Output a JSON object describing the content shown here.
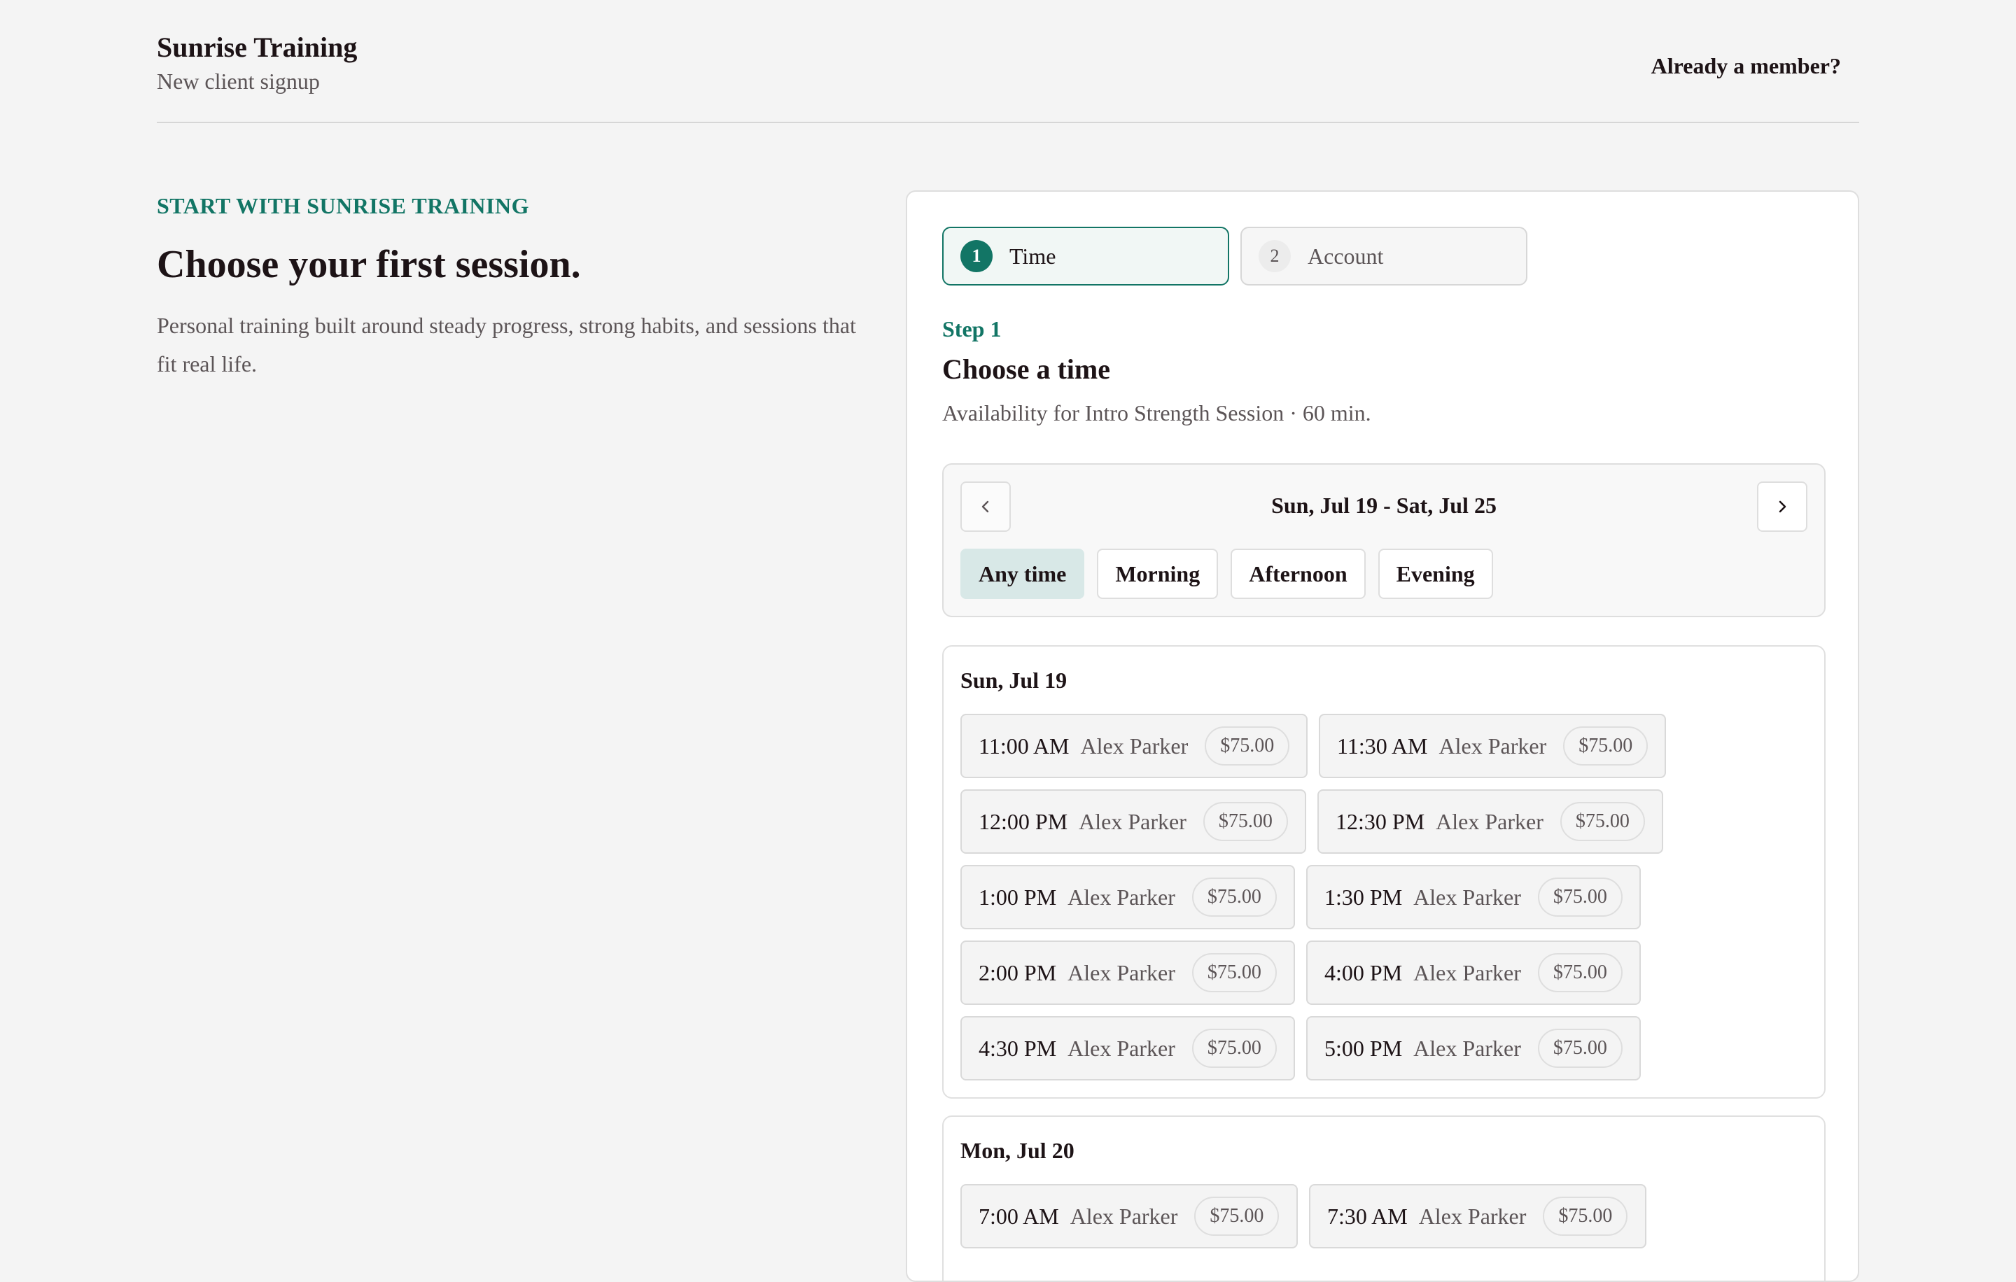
{
  "header": {
    "brand_name": "Sunrise Training",
    "brand_sub": "New client signup",
    "member_link": "Already a member?"
  },
  "intro": {
    "eyebrow": "START WITH SUNRISE TRAINING",
    "headline": "Choose your first session.",
    "text": "Personal training built around steady progress, strong habits, and sessions that fit real life."
  },
  "steps": [
    {
      "number": "1",
      "label": "Time",
      "active": true
    },
    {
      "number": "2",
      "label": "Account",
      "active": false
    }
  ],
  "step_content": {
    "eyebrow": "Step 1",
    "title": "Choose a time",
    "description": "Availability for Intro Strength Session · 60 min."
  },
  "week": {
    "range": "Sun, Jul 19 - Sat, Jul 25",
    "prev_icon": "chevron-left-icon",
    "next_icon": "chevron-right-icon",
    "filters": [
      "Any time",
      "Morning",
      "Afternoon",
      "Evening"
    ],
    "active_filter": "Any time"
  },
  "days": [
    {
      "title": "Sun, Jul 19",
      "slots": [
        {
          "time": "11:00 AM",
          "trainer": "Alex Parker",
          "price": "$75.00"
        },
        {
          "time": "11:30 AM",
          "trainer": "Alex Parker",
          "price": "$75.00"
        },
        {
          "time": "12:00 PM",
          "trainer": "Alex Parker",
          "price": "$75.00"
        },
        {
          "time": "12:30 PM",
          "trainer": "Alex Parker",
          "price": "$75.00"
        },
        {
          "time": "1:00 PM",
          "trainer": "Alex Parker",
          "price": "$75.00"
        },
        {
          "time": "1:30 PM",
          "trainer": "Alex Parker",
          "price": "$75.00"
        },
        {
          "time": "2:00 PM",
          "trainer": "Alex Parker",
          "price": "$75.00"
        },
        {
          "time": "4:00 PM",
          "trainer": "Alex Parker",
          "price": "$75.00"
        },
        {
          "time": "4:30 PM",
          "trainer": "Alex Parker",
          "price": "$75.00"
        },
        {
          "time": "5:00 PM",
          "trainer": "Alex Parker",
          "price": "$75.00"
        }
      ]
    },
    {
      "title": "Mon, Jul 20",
      "slots": [
        {
          "time": "7:00 AM",
          "trainer": "Alex Parker",
          "price": "$75.00"
        },
        {
          "time": "7:30 AM",
          "trainer": "Alex Parker",
          "price": "$75.00"
        }
      ]
    }
  ],
  "colors": {
    "accent": "#127565",
    "background": "#f4f4f4",
    "text": "#1d1316",
    "muted": "#5c5557"
  }
}
